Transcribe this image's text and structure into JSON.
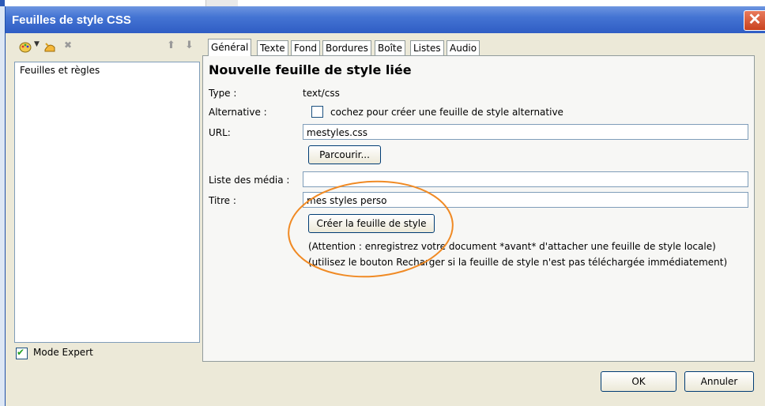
{
  "window": {
    "title": "Feuilles de style CSS",
    "close_symbol": "✕"
  },
  "left_panel": {
    "toolbar_icons": [
      "new-style-icon",
      "dropdown-arrow-icon",
      "create-rule-icon",
      "delete-icon",
      "move-up-icon",
      "move-down-icon"
    ],
    "tree_header": "Feuilles et règles",
    "expert_mode_label": "Mode Expert",
    "expert_mode_checked": true
  },
  "tabs": [
    {
      "label": "Général",
      "active": true
    },
    {
      "label": "Texte",
      "active": false
    },
    {
      "label": "Fond",
      "active": false
    },
    {
      "label": "Bordures",
      "active": false
    },
    {
      "label": "Boîte",
      "active": false
    },
    {
      "label": "Listes",
      "active": false
    },
    {
      "label": "Audio",
      "active": false
    }
  ],
  "general": {
    "heading": "Nouvelle feuille de style liée",
    "type_label": "Type :",
    "type_value": "text/css",
    "alternative_label": "Alternative :",
    "alternative_checkbox_label": "cochez pour créer une feuille de style alternative",
    "alternative_checked": false,
    "url_label": "URL:",
    "url_value": "mestyles.css",
    "browse_button": "Parcourir...",
    "media_label": "Liste des média :",
    "media_value": "",
    "title_label": "Titre :",
    "title_value": "mes styles perso",
    "create_button": "Créer la feuille de style",
    "note_1": "(Attention : enregistrez votre document *avant* d'attacher une feuille de style locale)",
    "note_2": "(utilisez le bouton Recharger si la feuille de style n'est pas téléchargée immédiatement)"
  },
  "footer": {
    "ok_button": "OK",
    "cancel_button": "Annuler"
  },
  "colors": {
    "titlebar": "#2f5dc4",
    "highlight_ellipse": "#f08a24",
    "checkmark": "#21a121"
  }
}
